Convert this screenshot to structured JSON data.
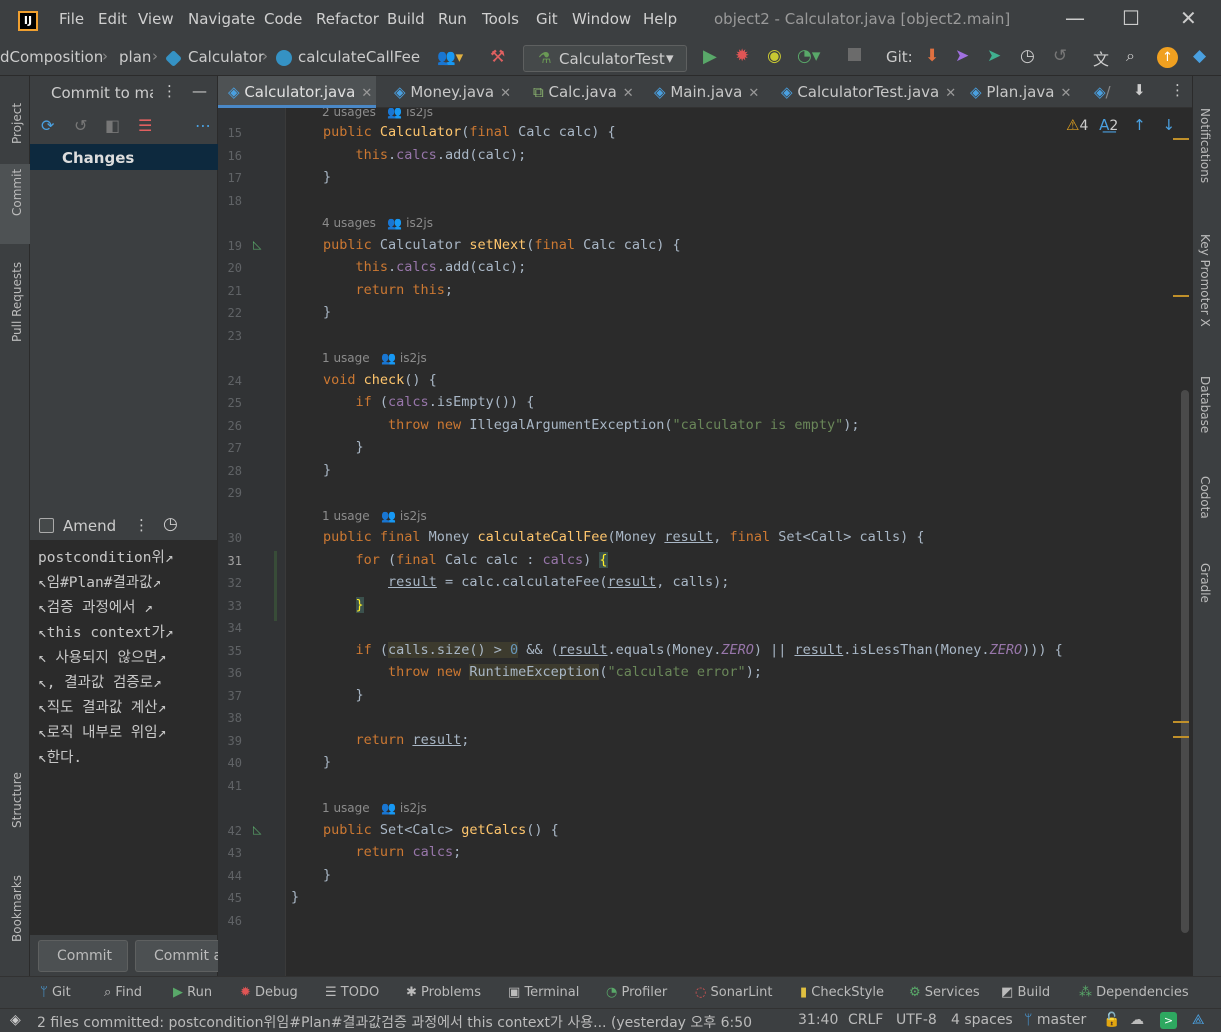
{
  "menu": [
    "File",
    "Edit",
    "View",
    "Navigate",
    "Code",
    "Refactor",
    "Build",
    "Run",
    "Tools",
    "Git",
    "Window",
    "Help"
  ],
  "window_title": "object2 - Calculator.java [object2.main]",
  "breadcrumb": {
    "b1": "dComposition",
    "b2": "plan",
    "b3": "Calculator",
    "b4": "calculateCallFee"
  },
  "run_config": "CalculatorTest",
  "git_label": "Git:",
  "tabs": [
    {
      "label": "Calculator.java"
    },
    {
      "label": "Money.java"
    },
    {
      "label": "Calc.java"
    },
    {
      "label": "Main.java"
    },
    {
      "label": "CalculatorTest.java"
    },
    {
      "label": "Plan.java"
    }
  ],
  "inspections": {
    "warnings": "4",
    "typos": "2"
  },
  "left_tools": {
    "project": "Project",
    "commit": "Commit",
    "pull_requests": "Pull Requests",
    "structure": "Structure",
    "bookmarks": "Bookmarks"
  },
  "right_tools": {
    "notifications": "Notifications",
    "key_promoter": "Key Promoter X",
    "database": "Database",
    "codota": "Codota",
    "gradle": "Gradle"
  },
  "commit_panel": {
    "title": "Commit to ma:",
    "changes": "Changes",
    "amend": "Amend",
    "message_lines": [
      "postcondition위↗",
      "↖임#Plan#결과값↗",
      "↖검증 과정에서 ↗",
      "↖this context가↗",
      "↖ 사용되지 않으면↗",
      "↖, 결과값 검증로↗",
      "↖직도 결과값 계산↗",
      "↖로직 내부로 위임↗",
      "↖한다."
    ],
    "commit_button": "Commit",
    "commit_push_button": "Commit a"
  },
  "code": {
    "line_numbers": [
      "15",
      "16",
      "17",
      "18",
      "19",
      "20",
      "21",
      "22",
      "23",
      "24",
      "25",
      "26",
      "27",
      "28",
      "29",
      "30",
      "31",
      "32",
      "33",
      "34",
      "35",
      "36",
      "37",
      "38",
      "39",
      "40",
      "41",
      "42",
      "43",
      "44",
      "45",
      "46"
    ],
    "hints": [
      {
        "usages": "2 usages",
        "author": "is2js"
      },
      {
        "usages": "4 usages",
        "author": "is2js"
      },
      {
        "usages": "1 usage",
        "author": "is2js"
      },
      {
        "usages": "1 usage",
        "author": "is2js"
      },
      {
        "usages": "1 usage",
        "author": "is2js"
      }
    ]
  },
  "bottom_tools": [
    "Git",
    "Find",
    "Run",
    "Debug",
    "TODO",
    "Problems",
    "Terminal",
    "Profiler",
    "SonarLint",
    "CheckStyle",
    "Services",
    "Build",
    "Dependencies"
  ],
  "status": {
    "message": "2 files committed: postcondition위임#Plan#결과값검증 과정에서 this context가 사용... (yesterday 오후 6:50",
    "position": "31:40",
    "line_sep": "CRLF",
    "encoding": "UTF-8",
    "indent": "4 spaces",
    "branch": "master"
  }
}
